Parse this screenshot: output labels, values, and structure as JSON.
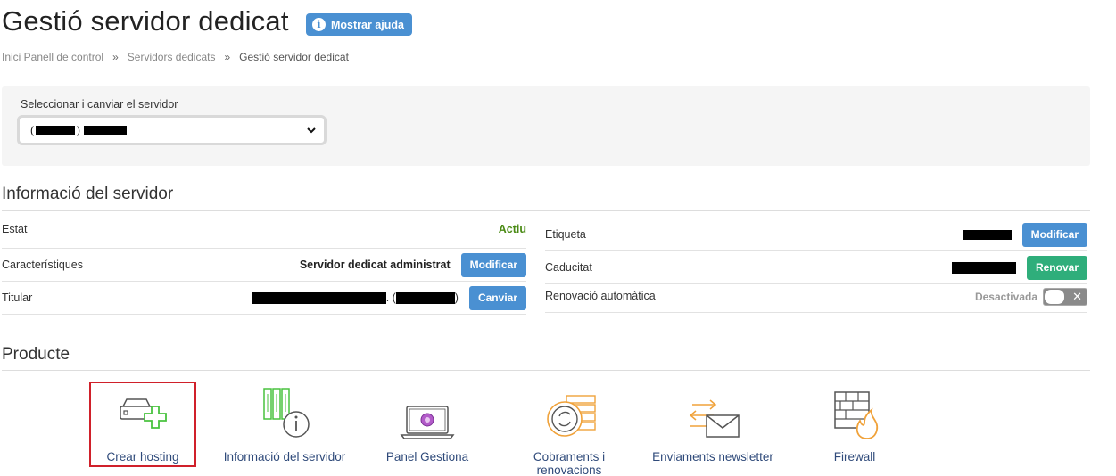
{
  "header": {
    "title": "Gestió servidor dedicat",
    "help_label": "Mostrar ajuda",
    "help_icon": "info-icon"
  },
  "breadcrumb": {
    "items": [
      "Inici Panell de control",
      "Servidors dedicats",
      "Gestió servidor dedicat"
    ],
    "separator": "»"
  },
  "server_selector": {
    "label": "Seleccionar i canviar el servidor",
    "open_paren": "(",
    "close_paren": ")"
  },
  "server_info": {
    "title": "Informació del servidor",
    "left": {
      "status_label": "Estat",
      "status_value": "Actiu",
      "features_label": "Característiques",
      "features_value": "Servidor dedicat administrat",
      "features_button": "Modificar",
      "owner_label": "Titular",
      "owner_sep": ". (",
      "owner_close": ")",
      "owner_button": "Canviar"
    },
    "right": {
      "tag_label": "Etiqueta",
      "tag_button": "Modificar",
      "expiry_label": "Caducitat",
      "expiry_button": "Renovar",
      "autorenew_label": "Renovació automàtica",
      "autorenew_state": "Desactivada",
      "autorenew_toggle": "✕"
    }
  },
  "product": {
    "title": "Producte",
    "items": [
      {
        "label": "Crear hosting",
        "icon": "server-plus-icon"
      },
      {
        "label": "Informació del servidor",
        "icon": "server-info-icon"
      },
      {
        "label": "Panel Gestiona",
        "icon": "laptop-icon"
      },
      {
        "label": "Cobraments i renovacions",
        "icon": "coins-icon"
      },
      {
        "label": "Enviaments newsletter",
        "icon": "newsletter-icon"
      },
      {
        "label": "Firewall",
        "icon": "firewall-icon"
      }
    ]
  },
  "colors": {
    "primary": "#4a90d2",
    "success": "#2fae7b",
    "status_active": "#4a8a14",
    "selected_border": "#d0202a",
    "icon_green": "#49c23f",
    "icon_orange": "#f0a23a"
  }
}
